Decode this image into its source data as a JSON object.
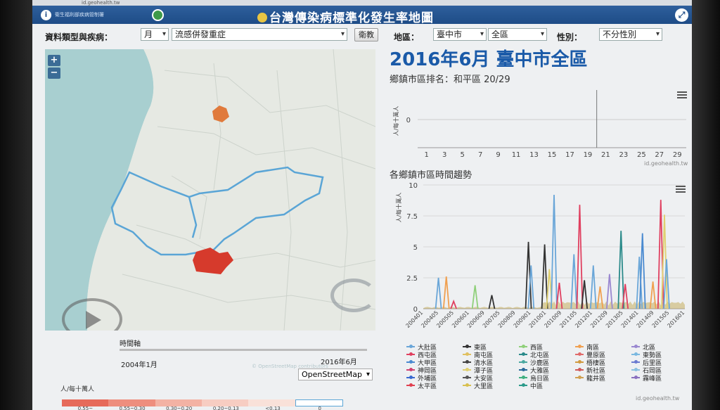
{
  "browser": {
    "url": "id.geohealth.tw"
  },
  "header": {
    "logo_text": "衛生福利部疾病管制署",
    "title": "台灣傳染病標準化發生率地圖",
    "info_icon": "info-icon",
    "share_icon": "share-icon"
  },
  "controls": {
    "type_label": "資料類型與疾病：",
    "period_value": "月",
    "disease_value": "流感併發重症",
    "apply_label": "衛教",
    "region_label": "地區：",
    "city_value": "臺中市",
    "district_value": "全區",
    "sex_label": "性別：",
    "sex_value": "不分性別"
  },
  "map": {
    "zoom_in": "+",
    "zoom_out": "−",
    "attribution": "© OpenStreetMap contributors",
    "layer_value": "OpenStreetMap",
    "colors": {
      "water": "#a8cfd0",
      "land": "#e6e9e3",
      "boundary": "#5aa5d6",
      "highlight": "#d63a2c",
      "north": "#e07a3c"
    }
  },
  "timeline": {
    "label": "時間軸",
    "start": "2004年1月",
    "end": "2016年6月"
  },
  "legend": {
    "unit": "人/每十萬人",
    "colors": [
      "#e66a5a",
      "#ee8e7e",
      "#f3b2a4",
      "#f7cdc2",
      "#f9e1d9",
      "#ffffff"
    ],
    "values": [
      "0.55~",
      "0.55~0.30",
      "0.30~0.20",
      "0.20~0.13",
      "<0.13",
      "0"
    ]
  },
  "right": {
    "title": "2016年6月 臺中市全區",
    "rank": "鄉鎮市區排名：和平區 20/29",
    "trend_title": "各鄉鎮市區時間趨勢",
    "credit1": "id.geohealth.tw",
    "credit2": "id.geohealth.tw"
  },
  "chart_data": [
    {
      "type": "bar",
      "ylabel": "人/每十萬人",
      "x": [
        1,
        3,
        5,
        7,
        9,
        11,
        13,
        15,
        17,
        19,
        21,
        23,
        25,
        27,
        29
      ],
      "y_ticks": [
        0
      ],
      "marker_x": 20
    },
    {
      "type": "line",
      "ylabel": "人/每十萬人",
      "y_ticks": [
        0,
        2.5,
        5,
        7.5,
        10
      ],
      "ylim": [
        0,
        10
      ],
      "x_ticks": [
        "200401",
        "200405",
        "200505",
        "200601",
        "200609",
        "200705",
        "200809",
        "200901",
        "201001",
        "201009",
        "201105",
        "201201",
        "201209",
        "201305",
        "201401",
        "201409",
        "201505",
        "201601"
      ],
      "series": [
        {
          "name": "大肚區",
          "color": "#6aa6d8"
        },
        {
          "name": "東區",
          "color": "#333333"
        },
        {
          "name": "西區",
          "color": "#8fd07a"
        },
        {
          "name": "南區",
          "color": "#f0a050"
        },
        {
          "name": "北區",
          "color": "#9a88d0"
        },
        {
          "name": "西屯區",
          "color": "#e04060"
        },
        {
          "name": "南屯區",
          "color": "#e0c060"
        },
        {
          "name": "北屯區",
          "color": "#2a8a8a"
        },
        {
          "name": "豐原區",
          "color": "#e06a6a"
        },
        {
          "name": "東勢區",
          "color": "#7ab8e0"
        },
        {
          "name": "大甲區",
          "color": "#4a8ad0"
        },
        {
          "name": "清水區",
          "color": "#444444"
        },
        {
          "name": "沙鹿區",
          "color": "#4aa8a0"
        },
        {
          "name": "梧棲區",
          "color": "#d09a40"
        },
        {
          "name": "后里區",
          "color": "#6a7ad0"
        },
        {
          "name": "神岡區",
          "color": "#d04070"
        },
        {
          "name": "潭子區",
          "color": "#e0d070"
        },
        {
          "name": "大雅區",
          "color": "#2a6a9a"
        },
        {
          "name": "新社區",
          "color": "#d05a5a"
        },
        {
          "name": "石岡區",
          "color": "#8ac0e0"
        },
        {
          "name": "外埔區",
          "color": "#3a6ad0"
        },
        {
          "name": "大安區",
          "color": "#555555"
        },
        {
          "name": "烏日區",
          "color": "#40b080"
        },
        {
          "name": "龍井區",
          "color": "#d0a050"
        },
        {
          "name": "霧峰區",
          "color": "#8a70c0"
        },
        {
          "name": "太平區",
          "color": "#e04050"
        },
        {
          "name": "大里區",
          "color": "#d8c050"
        },
        {
          "name": "中區",
          "color": "#2a9a8a"
        }
      ],
      "spikes": [
        {
          "x": 0.058,
          "y": 2.5,
          "series": 0
        },
        {
          "x": 0.088,
          "y": 2.6,
          "series": 3
        },
        {
          "x": 0.116,
          "y": 0.6,
          "series": 5
        },
        {
          "x": 0.198,
          "y": 1.9,
          "series": 2
        },
        {
          "x": 0.262,
          "y": 1.1,
          "series": 1
        },
        {
          "x": 0.402,
          "y": 5.4,
          "series": 1
        },
        {
          "x": 0.412,
          "y": 3.5,
          "series": 0
        },
        {
          "x": 0.464,
          "y": 5.2,
          "series": 1
        },
        {
          "x": 0.482,
          "y": 3.2,
          "series": 16
        },
        {
          "x": 0.5,
          "y": 9.2,
          "series": 0
        },
        {
          "x": 0.52,
          "y": 2.1,
          "series": 5
        },
        {
          "x": 0.576,
          "y": 4.4,
          "series": 0
        },
        {
          "x": 0.598,
          "y": 8.4,
          "series": 5
        },
        {
          "x": 0.616,
          "y": 2.3,
          "series": 1
        },
        {
          "x": 0.65,
          "y": 3.5,
          "series": 0
        },
        {
          "x": 0.676,
          "y": 1.8,
          "series": 3
        },
        {
          "x": 0.712,
          "y": 2.8,
          "series": 4
        },
        {
          "x": 0.756,
          "y": 6.3,
          "series": 7
        },
        {
          "x": 0.772,
          "y": 2.0,
          "series": 5
        },
        {
          "x": 0.826,
          "y": 4.2,
          "series": 0
        },
        {
          "x": 0.838,
          "y": 6.1,
          "series": 10
        },
        {
          "x": 0.878,
          "y": 2.2,
          "series": 3
        },
        {
          "x": 0.908,
          "y": 8.8,
          "series": 5
        },
        {
          "x": 0.922,
          "y": 7.6,
          "series": 16
        },
        {
          "x": 0.93,
          "y": 4.0,
          "series": 0
        }
      ]
    }
  ]
}
